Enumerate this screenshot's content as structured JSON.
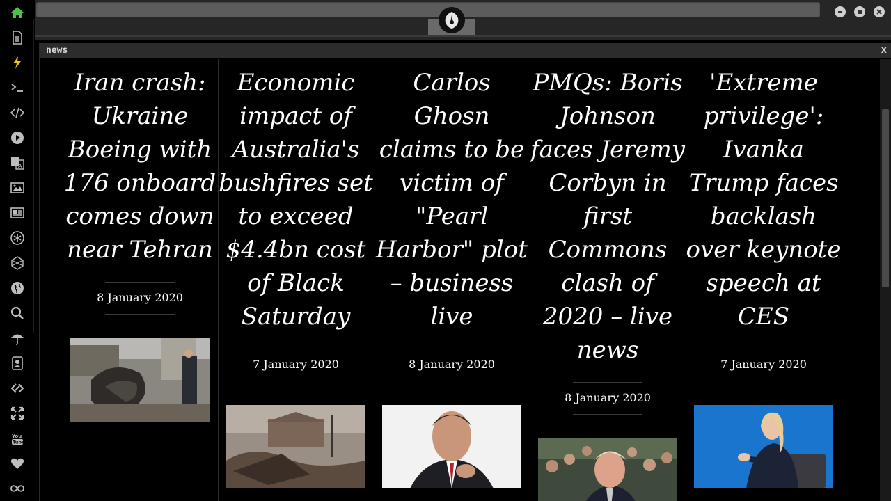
{
  "panel": {
    "title": "news",
    "close_label": "x"
  },
  "articles": [
    {
      "title": "Iran crash: Ukraine Boeing with 176 onboard comes down near Tehran",
      "date": "8 January 2020"
    },
    {
      "title": "Economic impact of Australia's bushfires set to exceed $4.4bn cost of Black Saturday",
      "date": "7 January 2020"
    },
    {
      "title": "Carlos Ghosn claims to be victim of \"Pearl Harbor\" plot – business live",
      "date": "8 January 2020"
    },
    {
      "title": "PMQs: Boris Johnson faces Jeremy Corbyn in first Commons clash of 2020 – live news",
      "date": "8 January 2020"
    },
    {
      "title": "'Extreme privilege': Ivanka Trump faces backlash over keynote speech at CES",
      "date": "7 January 2020"
    }
  ],
  "colors": {
    "accent_home": "#4fbf4f",
    "accent_bolt": "#f0c020",
    "icon": "#bdbdbd"
  },
  "icons": [
    "home-icon",
    "document-icon",
    "bolt-icon",
    "terminal-icon",
    "code-icon",
    "play-icon",
    "translate-icon",
    "image-icon",
    "news-icon",
    "asterisk-icon",
    "hexagon-icon",
    "globe-icon",
    "search-icon",
    "umbrella-icon",
    "contact-icon",
    "link-icon",
    "expand-icon",
    "youtube-icon",
    "heart-icon",
    "infinity-icon"
  ]
}
